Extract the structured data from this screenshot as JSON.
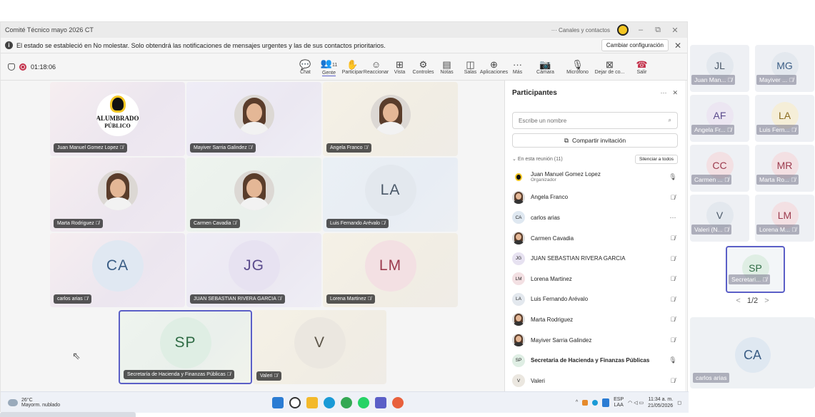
{
  "window": {
    "title": "Comité Técnico mayo 2026 CT",
    "channels_contacts": "Canales y contactos",
    "minimize": "–",
    "restore": "⧉",
    "close": "✕"
  },
  "notification": {
    "message": "El estado se estableció en No molestar. Solo obtendrá las notificaciones de mensajes urgentes y las de sus contactos prioritarios.",
    "change_settings": "Cambiar configuración",
    "close": "✕"
  },
  "toolbar": {
    "timer": "01:18:06",
    "people_count": "11",
    "buttons": [
      {
        "label": "Chat",
        "icon": "chat-icon",
        "glyph": "💬"
      },
      {
        "label": "Gente",
        "icon": "people-icon",
        "glyph": "👥"
      },
      {
        "label": "Participar",
        "icon": "raise-hand-icon",
        "glyph": "✋"
      },
      {
        "label": "Reaccionar",
        "icon": "smiley-icon",
        "glyph": "☺"
      },
      {
        "label": "Vista",
        "icon": "grid-view-icon",
        "glyph": "⊞"
      },
      {
        "label": "Controles",
        "icon": "controls-icon",
        "glyph": "⚙"
      },
      {
        "label": "Notas",
        "icon": "notes-icon",
        "glyph": "▤"
      },
      {
        "label": "Salas",
        "icon": "rooms-icon",
        "glyph": "◫"
      },
      {
        "label": "Aplicaciones",
        "icon": "apps-icon",
        "glyph": "⊕"
      },
      {
        "label": "Más",
        "icon": "more-icon",
        "glyph": "···"
      },
      {
        "label": "Cámara",
        "icon": "camera-off-icon",
        "glyph": "📷"
      },
      {
        "label": "Micrófono",
        "icon": "microphone-icon",
        "glyph": "🎙"
      },
      {
        "label": "Dejar de co...",
        "icon": "stop-sharing-icon",
        "glyph": "⊠"
      },
      {
        "label": "Salir",
        "icon": "leave-phone-icon",
        "glyph": "☎"
      }
    ]
  },
  "stage": {
    "tiles": [
      {
        "name": "Juan Manuel Gomez Lopez",
        "kind": "logo",
        "logo_line1": "ALUMBRADO",
        "logo_line2": "PÚBLICO",
        "bg": "g-pink"
      },
      {
        "name": "Mayiver Sarria Galindez",
        "kind": "photo",
        "bg": "g-lilac"
      },
      {
        "name": "Angela Franco",
        "kind": "photo",
        "bg": "g-gold"
      },
      {
        "name": "Marta Rodriguez",
        "kind": "photo",
        "bg": "g-pink"
      },
      {
        "name": "Carmen Cavadia",
        "kind": "photo",
        "bg": "g-green"
      },
      {
        "name": "Luis Fernando Arévalo",
        "kind": "initials",
        "initials": "LA",
        "bg": "g-blue",
        "circle": "#e3e8ee",
        "color": "#4a5868"
      },
      {
        "name": "carlos arias",
        "kind": "initials",
        "initials": "CA",
        "bg": "g-pink",
        "circle": "#e0e8f2",
        "color": "#3a5d85"
      },
      {
        "name": "JUAN SEBASTIAN RIVERA GARCIA",
        "kind": "initials",
        "initials": "JG",
        "bg": "g-lilac",
        "circle": "#e7e2f1",
        "color": "#5a4a8c"
      },
      {
        "name": "Lorena Martinez",
        "kind": "initials",
        "initials": "LM",
        "bg": "g-gold",
        "circle": "#f3e0e3",
        "color": "#9c3a4d"
      },
      {
        "name": "Secretaría de Hacienda y Finanzas Públicas",
        "kind": "initials",
        "initials": "SP",
        "bg": "g-green",
        "circle": "#dfeee4",
        "color": "#2e6b44"
      },
      {
        "name": "Valeri",
        "kind": "initials",
        "initials": "V",
        "bg": "g-gold",
        "circle": "#ebe7e0",
        "color": "#5b5448"
      }
    ]
  },
  "panel": {
    "title": "Participantes",
    "more": "···",
    "close": "✕",
    "search_placeholder": "Escribe un nombre",
    "share_invite": "Compartir invitación",
    "in_meeting": "En esta reunión (11)",
    "mute_all": "Silenciar a todos",
    "participants": [
      {
        "name": "Juan Manuel Gomez Lopez",
        "sub": "Organizador",
        "initials": "",
        "avatar": "logo",
        "status": "🎙",
        "bold": false
      },
      {
        "name": "Angela Franco",
        "sub": "",
        "initials": "",
        "avatar": "photo",
        "status": "🎙̸",
        "bold": false
      },
      {
        "name": "carlos arias",
        "sub": "",
        "initials": "CA",
        "avatar": "#dfe8f1",
        "status": "···",
        "bold": false
      },
      {
        "name": "Carmen Cavadia",
        "sub": "",
        "initials": "",
        "avatar": "photo",
        "status": "🎙̸",
        "bold": false
      },
      {
        "name": "JUAN SEBASTIAN RIVERA GARCIA",
        "sub": "",
        "initials": "JG",
        "avatar": "#e7e2f1",
        "status": "🎙̸",
        "bold": false
      },
      {
        "name": "Lorena Martinez",
        "sub": "",
        "initials": "LM",
        "avatar": "#f3e0e3",
        "status": "🎙̸",
        "bold": false
      },
      {
        "name": "Luis Fernando Arévalo",
        "sub": "",
        "initials": "LA",
        "avatar": "#e3e8ee",
        "status": "🎙̸",
        "bold": false
      },
      {
        "name": "Marta Rodriguez",
        "sub": "",
        "initials": "",
        "avatar": "photo",
        "status": "🎙̸",
        "bold": false
      },
      {
        "name": "Mayiver Sarria Galindez",
        "sub": "",
        "initials": "",
        "avatar": "photo",
        "status": "🎙̸",
        "bold": false
      },
      {
        "name": "Secretaria de Hacienda y Finanzas Públicas",
        "sub": "",
        "initials": "SP",
        "avatar": "#dfeee4",
        "status": "🎙",
        "bold": true
      },
      {
        "name": "Valeri",
        "sub": "",
        "initials": "V",
        "avatar": "#ebe7e0",
        "status": "🎙̸",
        "bold": false
      }
    ]
  },
  "taskbar": {
    "temp": "26°C",
    "weather": "Mayorm. nublado",
    "lang_top": "ESP",
    "lang_bottom": "LAA",
    "time": "11:34 a. m.",
    "date": "21/05/2026"
  },
  "gallery": {
    "tiles": [
      {
        "initials": "JL",
        "name": "Juan Man...",
        "circle": "#e3e8ee",
        "color": "#4a5868"
      },
      {
        "initials": "MG",
        "name": "Mayiver ...",
        "circle": "#e3e8ee",
        "color": "#3a5d85"
      },
      {
        "initials": "AF",
        "name": "Angela Fr...",
        "circle": "#ece6f2",
        "color": "#5a4a8c"
      },
      {
        "initials": "LA",
        "name": "Luis Fern...",
        "circle": "#f5eed8",
        "color": "#8a6b1e"
      },
      {
        "initials": "CC",
        "name": "Carmen ...",
        "circle": "#f3e0e3",
        "color": "#9c3a4d"
      },
      {
        "initials": "MR",
        "name": "Marta Ro...",
        "circle": "#f3e0e3",
        "color": "#9c3a4d"
      },
      {
        "initials": "V",
        "name": "Valeri (N...",
        "circle": "#e3e8ee",
        "color": "#4a5868"
      },
      {
        "initials": "LM",
        "name": "Lorena M...",
        "circle": "#f3e0e3",
        "color": "#9c3a4d"
      },
      {
        "initials": "SP",
        "name": "Secretari...",
        "circle": "#dfeee4",
        "color": "#2e6b44"
      }
    ],
    "pager": "1/2",
    "big": {
      "initials": "CA",
      "name": "carlos arias"
    }
  },
  "colors": {
    "accent": "#5b5fc7",
    "leave": "#c4314b"
  }
}
